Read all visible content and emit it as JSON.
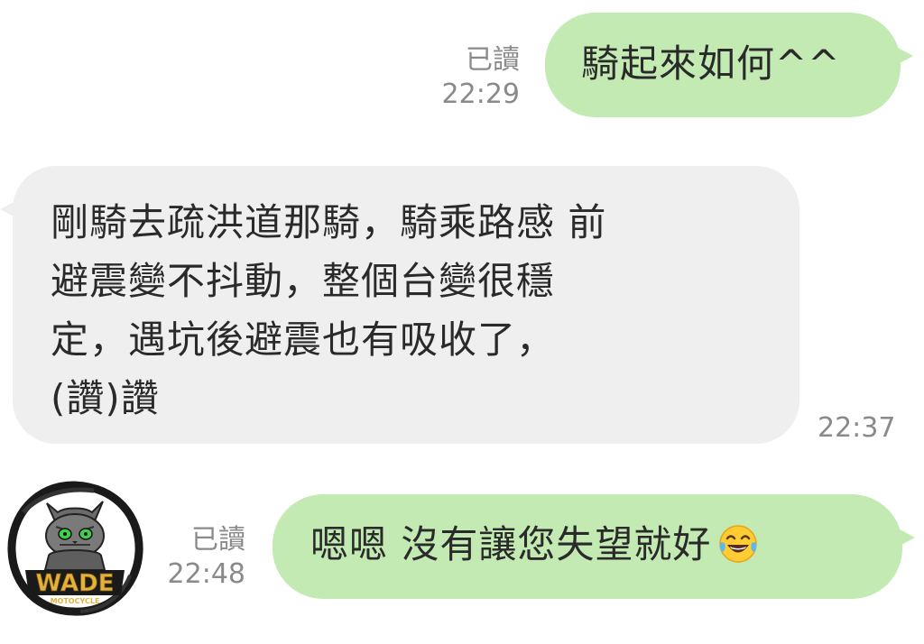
{
  "messages": [
    {
      "direction": "outgoing",
      "text": "騎起來如何^^",
      "read_label": "已讀",
      "time": "22:29"
    },
    {
      "direction": "incoming",
      "lines": [
        "剛騎去疏洪道那騎，騎乘路感 前",
        "避震變不抖動，整個台變很穩",
        "定，遇坑後避震也有吸收了，",
        "(讚)讚"
      ],
      "time": "22:37"
    },
    {
      "direction": "outgoing",
      "text": "嗯嗯 沒有讓您失望就好",
      "emoji": "tears-of-joy-emoji",
      "read_label": "已讀",
      "time": "22:48"
    }
  ],
  "avatar": {
    "icon": "cat-mascot-logo-icon",
    "logo_text": "WADE",
    "logo_subtext": "MOTOCYCLE"
  },
  "colors": {
    "outgoing_bubble": "#c2eab2",
    "incoming_bubble": "#efefef",
    "meta_text": "#8a8a8a"
  }
}
